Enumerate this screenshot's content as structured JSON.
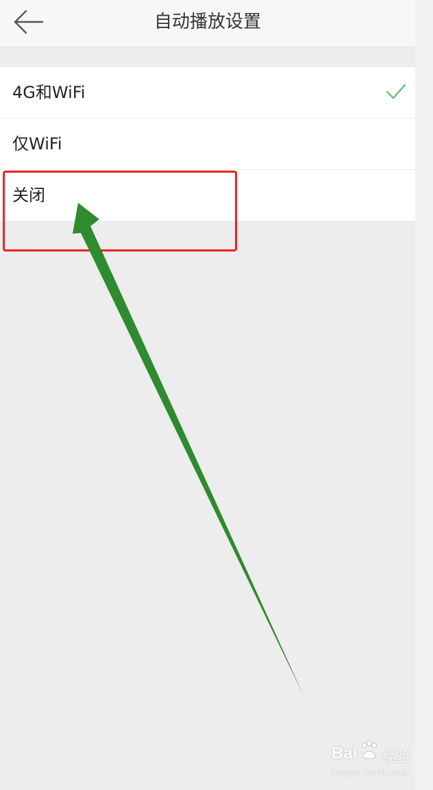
{
  "header": {
    "title": "自动播放设置",
    "back_icon": "arrow-left-icon"
  },
  "options": [
    {
      "label": "4G和WiFi",
      "selected": true
    },
    {
      "label": "仅WiFi",
      "selected": false
    },
    {
      "label": "关闭",
      "selected": false
    }
  ],
  "colors": {
    "check": "#62c27a",
    "highlight_box": "#f02020",
    "arrow": "#2e8b2e"
  },
  "watermark": {
    "brand": "Bai",
    "brand_suffix": "经验",
    "domain": "jingyan.baidu.com"
  }
}
